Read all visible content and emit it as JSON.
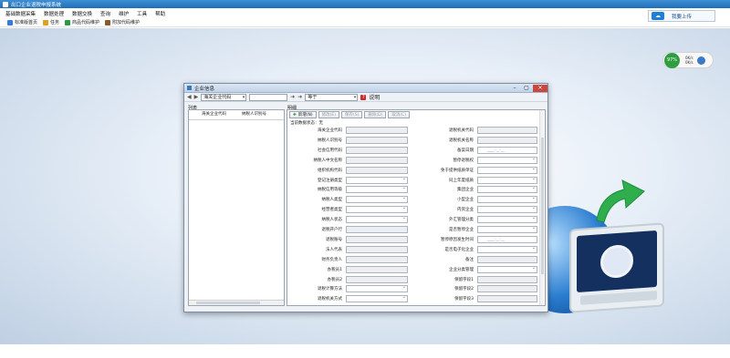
{
  "window": {
    "title": "出口企业退税申报系统"
  },
  "menu": [
    "基础数据采集",
    "数据处理",
    "数据交换",
    "查询",
    "维护",
    "工具",
    "帮助"
  ],
  "toolbar": [
    {
      "label": "标准版首页",
      "color": "#3a7bd5"
    },
    {
      "label": "任务",
      "color": "#e0a020"
    },
    {
      "label": "商品代码维护",
      "color": "#2d9a43"
    },
    {
      "label": "附加代码维护",
      "color": "#8b5a2b"
    }
  ],
  "topright": {
    "label": "我要上传"
  },
  "gauge": {
    "percent": "97%",
    "up": "0K/s",
    "down": "0K/s"
  },
  "dialog": {
    "title": "企业信息",
    "search_field": "海关企业代码",
    "condition": "等于",
    "help": "说明",
    "list_header": "列表",
    "detail_header": "明细",
    "list_columns": [
      "海关企业代码",
      "纳税人识别号"
    ],
    "buttons": [
      {
        "label": "新增(N)",
        "enabled": true
      },
      {
        "label": "修改(E)",
        "enabled": false
      },
      {
        "label": "保存(S)",
        "enabled": false
      },
      {
        "label": "删除(D)",
        "enabled": false
      },
      {
        "label": "取消(C)",
        "enabled": false
      }
    ],
    "status": "当前数据状态：无",
    "fields_left": [
      "海关企业代码",
      "纳税人识别号",
      "社会信用代码",
      "纳税人中文名称",
      "组织机构代码",
      "登记注册类型",
      "纳税信用等级",
      "纳税人类型",
      "经营者类型",
      "纳税人状态",
      "退税开户行",
      "退税账号",
      "法人代表",
      "财务负责人",
      "办税员1",
      "办税员2",
      "退税计算方法",
      "退税机关方式"
    ],
    "fields_right": [
      "退税机关代码",
      "退税机关名称",
      "备案日期",
      "暂停退税权",
      "免于提供纸质单证",
      "同上年度纸质",
      "集团企业",
      "小型企业",
      "内资企业",
      "外汇管理分类",
      "是否暂停企业",
      "暂停原因发生时间",
      "是否电子化企业",
      "备注",
      "企业分类管理",
      "保留字段1",
      "保留字段2",
      "保留字段3"
    ],
    "date_placeholder": "____-__-__"
  }
}
